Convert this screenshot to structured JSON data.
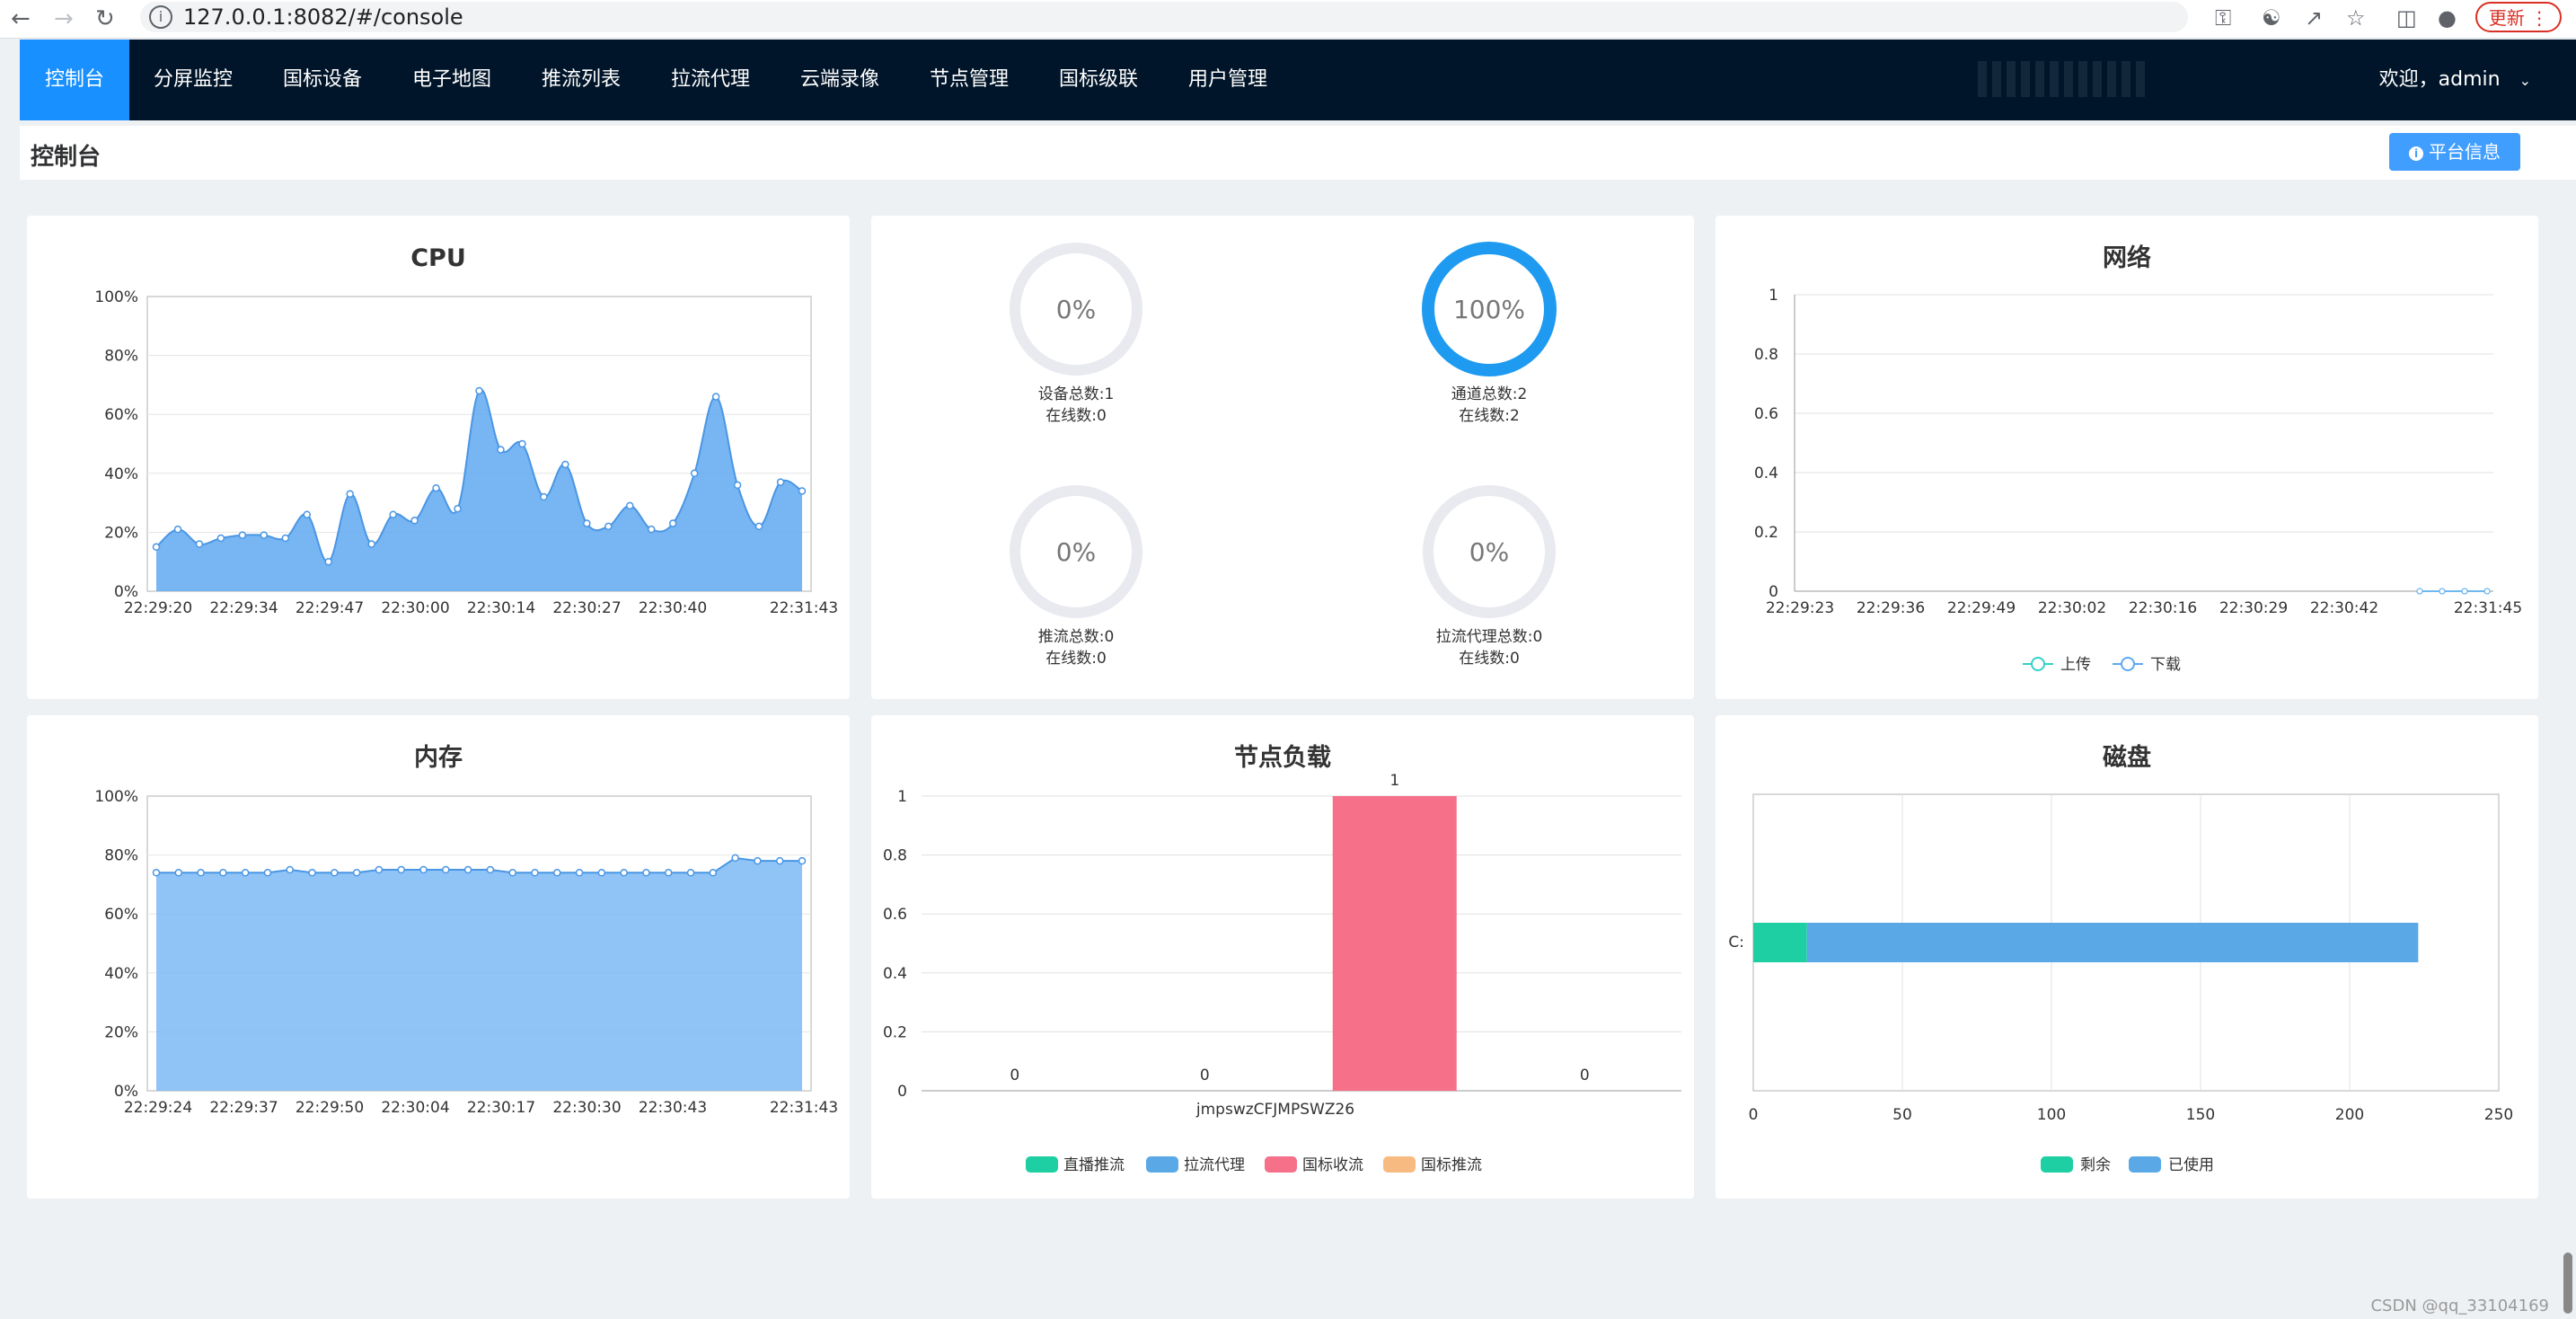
{
  "browser": {
    "url": "127.0.0.1:8082/#/console",
    "update_label": "更新"
  },
  "header": {
    "nav": [
      "控制台",
      "分屏监控",
      "国标设备",
      "电子地图",
      "推流列表",
      "拉流代理",
      "云端录像",
      "节点管理",
      "国标级联",
      "用户管理"
    ],
    "active_index": 0,
    "user_greeting": "欢迎，admin"
  },
  "page": {
    "title": "控制台",
    "platform_button": "平台信息"
  },
  "cpu": {
    "title": "CPU",
    "chart_data": {
      "type": "area",
      "title": "CPU",
      "y_ticks": [
        "0%",
        "20%",
        "40%",
        "60%",
        "80%",
        "100%"
      ],
      "ylim": [
        0,
        100
      ],
      "x_tick_labels": [
        "22:29:20",
        "22:29:34",
        "22:29:47",
        "22:30:00",
        "22:30:14",
        "22:30:27",
        "22:30:40",
        "22:31:43"
      ],
      "values": [
        15,
        21,
        16,
        18,
        19,
        19,
        18,
        26,
        10,
        33,
        16,
        26,
        24,
        35,
        28,
        68,
        48,
        50,
        32,
        43,
        23,
        22,
        29,
        21,
        23,
        40,
        66,
        36,
        22,
        37,
        34
      ],
      "color": "#5fa8f1"
    }
  },
  "network": {
    "title": "网络",
    "chart_data": {
      "type": "line",
      "title": "网络",
      "y_ticks": [
        "0",
        "0.2",
        "0.4",
        "0.6",
        "0.8",
        "1"
      ],
      "ylim": [
        0,
        1
      ],
      "x_tick_labels": [
        "22:29:23",
        "22:29:36",
        "22:29:49",
        "22:30:02",
        "22:30:16",
        "22:30:29",
        "22:30:42",
        "22:31:45"
      ],
      "series": [
        {
          "name": "上传",
          "values": [
            0,
            0,
            0,
            0
          ],
          "color": "#36cfc9"
        },
        {
          "name": "下载",
          "values": [
            0,
            0,
            0,
            0
          ],
          "color": "#5fa8f1"
        }
      ],
      "legend": "bottom"
    }
  },
  "memory": {
    "title": "内存",
    "chart_data": {
      "type": "area",
      "title": "内存",
      "y_ticks": [
        "0%",
        "20%",
        "40%",
        "60%",
        "80%",
        "100%"
      ],
      "ylim": [
        0,
        100
      ],
      "x_tick_labels": [
        "22:29:24",
        "22:29:37",
        "22:29:50",
        "22:30:04",
        "22:30:17",
        "22:30:30",
        "22:30:43",
        "22:31:43"
      ],
      "values": [
        74,
        74,
        74,
        74,
        74,
        74,
        75,
        74,
        74,
        74,
        75,
        75,
        75,
        75,
        75,
        75,
        74,
        74,
        74,
        74,
        74,
        74,
        74,
        74,
        74,
        74,
        79,
        78,
        78,
        78
      ],
      "color": "#7db8f5"
    }
  },
  "gauges": [
    {
      "value": "0%",
      "percent": 0,
      "line1": "设备总数:1",
      "line2": "在线数:0"
    },
    {
      "value": "100%",
      "percent": 100,
      "line1": "通道总数:2",
      "line2": "在线数:2"
    },
    {
      "value": "0%",
      "percent": 0,
      "line1": "推流总数:0",
      "line2": "在线数:0"
    },
    {
      "value": "0%",
      "percent": 0,
      "line1": "拉流代理总数:0",
      "line2": "在线数:0"
    }
  ],
  "node_load": {
    "title": "节点负载",
    "chart_data": {
      "type": "bar",
      "title": "节点负载",
      "categories": [
        "jmpswzCFJMPSWZ26"
      ],
      "y_ticks": [
        "0",
        "0.2",
        "0.4",
        "0.6",
        "0.8",
        "1"
      ],
      "ylim": [
        0,
        1
      ],
      "series": [
        {
          "name": "直播推流",
          "values": [
            0
          ],
          "color": "#1ecfa3"
        },
        {
          "name": "拉流代理",
          "values": [
            0
          ],
          "color": "#5aa9e6"
        },
        {
          "name": "国标收流",
          "values": [
            1
          ],
          "color": "#f6708a"
        },
        {
          "name": "国标推流",
          "values": [
            0
          ],
          "color": "#f7bb82"
        }
      ],
      "data_labels": [
        "0",
        "0",
        "1",
        "0"
      ],
      "legend": "bottom"
    }
  },
  "disk": {
    "title": "磁盘",
    "chart_data": {
      "type": "bar",
      "orientation": "horizontal",
      "stacked": true,
      "title": "磁盘",
      "categories": [
        "C:"
      ],
      "x_ticks": [
        "0",
        "50",
        "100",
        "150",
        "200",
        "250"
      ],
      "xlim": [
        0,
        250
      ],
      "series": [
        {
          "name": "剩余",
          "values": [
            18
          ],
          "color": "#1ecfa3"
        },
        {
          "name": "已使用",
          "values": [
            205
          ],
          "color": "#5aa9e6"
        }
      ],
      "legend": "bottom"
    }
  },
  "watermark": "CSDN @qq_33104169"
}
